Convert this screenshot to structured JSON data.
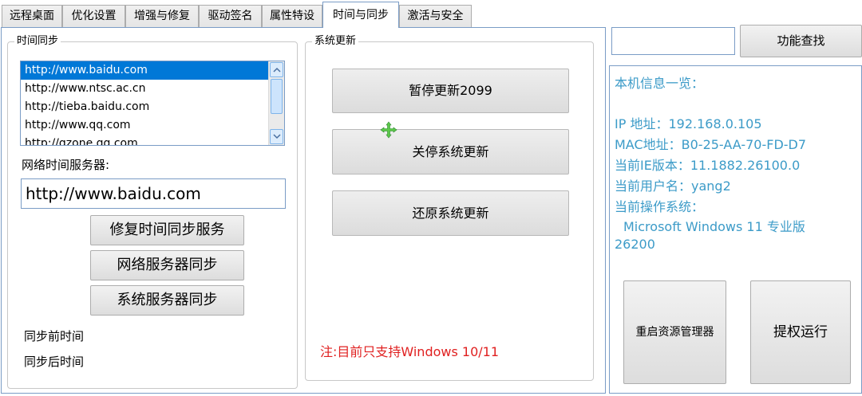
{
  "tabs": [
    {
      "label": "远程桌面"
    },
    {
      "label": "优化设置"
    },
    {
      "label": "增强与修复"
    },
    {
      "label": "驱动签名"
    },
    {
      "label": "属性特设"
    },
    {
      "label": "时间与同步"
    },
    {
      "label": "激活与安全"
    }
  ],
  "time_sync": {
    "group_label": "时间同步",
    "servers": [
      "http://www.baidu.com",
      "http://www.ntsc.ac.cn",
      "http://tieba.baidu.com",
      "http://www.qq.com",
      "http://qzone.qq.com"
    ],
    "server_label": "网络时间服务器:",
    "server_value": "http://www.baidu.com",
    "btn_repair": "修复时间同步服务",
    "btn_network_sync": "网络服务器同步",
    "btn_system_sync": "系统服务器同步",
    "before_label": "同步前时间",
    "after_label": "同步后时间"
  },
  "system_update": {
    "group_label": "系统更新",
    "btn_pause": "暂停更新2099",
    "btn_disable": "关停系统更新",
    "btn_restore": "还原系统更新",
    "note": "注:目前只支持Windows 10/11"
  },
  "right_panel": {
    "search_value": "",
    "btn_search": "功能查找",
    "info_title": "本机信息一览：",
    "ip_line": "IP 地址：192.168.0.105",
    "mac_line": "MAC地址：B0-25-AA-70-FD-D7",
    "ie_line": "当前IE版本：11.1882.26100.0",
    "user_line": "当前用户名：yang2",
    "os_label": "当前操作系统：",
    "os_name": "Microsoft Windows 11 专业版",
    "os_build": "26200",
    "btn_restart_explorer": "重启资源管理器",
    "btn_elevate": "提权运行"
  },
  "colors": {
    "info_text": "#3c9bc8",
    "note_text": "#e02020",
    "selection": "#0078d7",
    "move_icon": "#5cc84a"
  }
}
